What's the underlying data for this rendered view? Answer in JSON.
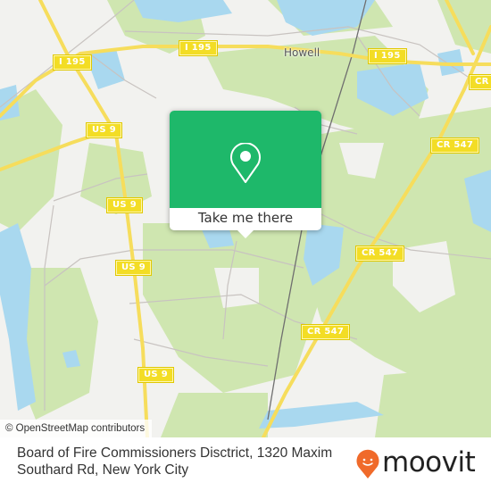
{
  "map": {
    "place_labels": [
      {
        "name": "Howell"
      }
    ],
    "road_shields": [
      {
        "label": "I 195"
      },
      {
        "label": "I 195"
      },
      {
        "label": "I 195"
      },
      {
        "label": "US 9"
      },
      {
        "label": "US 9"
      },
      {
        "label": "US 9"
      },
      {
        "label": "US 9"
      },
      {
        "label": "CR 547"
      },
      {
        "label": "CR 547"
      },
      {
        "label": "CR 547"
      },
      {
        "label": "CR"
      }
    ],
    "attribution": "© OpenStreetMap contributors",
    "colors": {
      "land": "#f2f2ef",
      "park": "#cfe6b0",
      "water": "#a9d8ef",
      "highway": "#f6dd5c",
      "minor_road": "#c8c3c0",
      "rail": "#6f6f6f"
    }
  },
  "popup": {
    "icon": "location-pin-icon",
    "button_label": "Take me there",
    "accent_color": "#1eb86a"
  },
  "footer": {
    "title": "Board of Fire Commissioners Disctrict, 1320 Maxim Southard Rd, New York City",
    "logo_text": "moovit",
    "logo_icon": "moovit-smiley-pin-icon",
    "logo_color": "#f06a2a"
  }
}
